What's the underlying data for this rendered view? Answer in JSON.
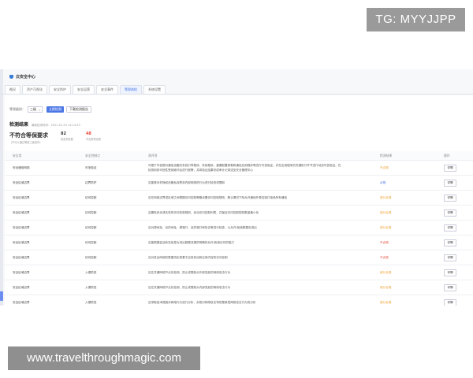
{
  "overlays": {
    "tg": "TG: MYYJJPP",
    "site": "www.travelthroughmagic.com"
  },
  "app": {
    "title": "云安全中心"
  },
  "tabs": [
    {
      "label": "概况"
    },
    {
      "label": "资产可视化"
    },
    {
      "label": "安全防护"
    },
    {
      "label": "安全运营"
    },
    {
      "label": "安全事件"
    },
    {
      "label": "等保体检"
    },
    {
      "label": "系统设置"
    }
  ],
  "controls": {
    "level_label": "等保级别：",
    "level_value": "三级",
    "check_now": "立即检测",
    "download": "下载检测报告"
  },
  "result": {
    "title": "检测结果",
    "time": "最新检测时间：2021-01-29 14:14:53",
    "verdict": "不符合等保要求",
    "verdict_note": "（不可以通过等保三级测评）",
    "check_count": "82",
    "check_label": "检查项总数",
    "fail_count": "48",
    "fail_label": "不合规项总数"
  },
  "columns": {
    "name": "安全类",
    "type": "安全控制点",
    "desc": "测评项",
    "status": "检测结果",
    "op": "操作"
  },
  "rows": [
    {
      "name": "安全通信网络",
      "type": "可信验证",
      "desc": "可基于可信根对通信设备的系统引导程序、系统程序、重要配置参数和通信应用程序等进行可信验证，并在应用程序的关键执行环节进行动态可信验证，在检测到其可信性受到破坏后进行报警，并将验证结果形成审计记录送至安全管理中心",
      "status": "不合规",
      "status_color": "#f0a030",
      "detail": "详情",
      "twoline": true
    },
    {
      "name": "安全区域边界",
      "type": "边界防护",
      "desc": "应能够对非授权设备私自联到内部网络的行为进行检查或限制",
      "status": "合规",
      "status_color": "#4b76e6",
      "detail": "详情"
    },
    {
      "name": "安全区域边界",
      "type": "访问控制",
      "desc": "应在网络边界或区域之间根据访问控制策略设置访问控制规则，默认情况下除允许通信外受控接口拒绝所有通信",
      "status": "部分合规",
      "status_color": "#f0a030",
      "detail": "详情"
    },
    {
      "name": "安全区域边界",
      "type": "访问控制",
      "desc": "应删除多余或无效的访问控制规则，优化访问控制列表，并保证访问控制规则数量最小化",
      "status": "部分合规",
      "status_color": "#f0a030",
      "detail": "详情"
    },
    {
      "name": "安全区域边界",
      "type": "访问控制",
      "desc": "应对源地址、目的地址、源端口、目的端口和协议等进行检查，以允许/拒绝数据包进出",
      "status": "部分合规",
      "status_color": "#f0a030",
      "detail": "详情"
    },
    {
      "name": "安全区域边界",
      "type": "访问控制",
      "desc": "应能根据会话状态信息为进出数据流提供明确的允许/拒绝访问的能力",
      "status": "不合规",
      "status_color": "#e64a3b",
      "detail": "详情"
    },
    {
      "name": "安全区域边界",
      "type": "访问控制",
      "desc": "应对进出网络的数据流实现基于应用协议和应用内容的访问控制",
      "status": "不合规",
      "status_color": "#e64a3b",
      "detail": "详情"
    },
    {
      "name": "安全区域边界",
      "type": "入侵防范",
      "desc": "应在关键网络节点处检测、防止或限制从外部发起的网络攻击行为",
      "status": "部分合规",
      "status_color": "#f0a030",
      "detail": "详情"
    },
    {
      "name": "安全区域边界",
      "type": "入侵防范",
      "desc": "应在关键网络节点处检测、防止或限制从内部发起的网络攻击行为",
      "status": "部分合规",
      "status_color": "#f0a030",
      "detail": "详情"
    },
    {
      "name": "安全区域边界",
      "type": "入侵防范",
      "desc": "应采取技术措施对网络行为进行分析，实现对网络攻击特别是新型网络攻击行为的分析",
      "status": "部分合规",
      "status_color": "#f0a030",
      "detail": "详情"
    }
  ]
}
